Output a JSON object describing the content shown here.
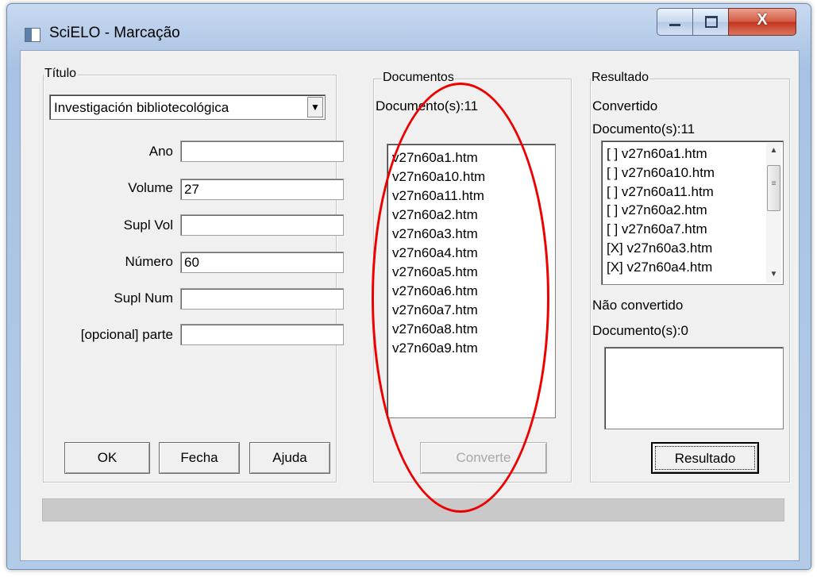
{
  "window": {
    "title": "SciELO - Marcação"
  },
  "caption": {
    "minimize": "–",
    "close": "X"
  },
  "titulo": {
    "legend": "Título",
    "selected": "Investigación bibliotecológica",
    "arrow": "▼",
    "fields": [
      {
        "label": "Ano",
        "value": ""
      },
      {
        "label": "Volume",
        "value": "27"
      },
      {
        "label": "Supl Vol",
        "value": ""
      },
      {
        "label": "Número",
        "value": "60"
      },
      {
        "label": "Supl Num",
        "value": ""
      },
      {
        "label": "[opcional] parte",
        "value": ""
      }
    ],
    "buttons": {
      "ok": "OK",
      "fecha": "Fecha",
      "ajuda": "Ajuda"
    }
  },
  "documentos": {
    "legend": "Documentos",
    "count": "Documento(s):11",
    "items": [
      "v27n60a1.htm",
      "v27n60a10.htm",
      "v27n60a11.htm",
      "v27n60a2.htm",
      "v27n60a3.htm",
      "v27n60a4.htm",
      "v27n60a5.htm",
      "v27n60a6.htm",
      "v27n60a7.htm",
      "v27n60a8.htm",
      "v27n60a9.htm"
    ],
    "converte": "Converte"
  },
  "resultado": {
    "legend": "Resultado",
    "convertido_label": "Convertido",
    "convertido_count": "Documento(s):11",
    "convertido_items": [
      "[ ] v27n60a1.htm",
      "[ ] v27n60a10.htm",
      "[ ] v27n60a11.htm",
      "[ ] v27n60a2.htm",
      "[ ] v27n60a7.htm",
      "[X] v27n60a3.htm",
      "[X] v27n60a4.htm"
    ],
    "nao_label": "Não convertido",
    "nao_count": "Documento(s):0",
    "button": "Resultado"
  },
  "colors": {
    "annotation": "#ee0000",
    "title_bar": "#b7cde9",
    "close_button": "#c3341c"
  }
}
